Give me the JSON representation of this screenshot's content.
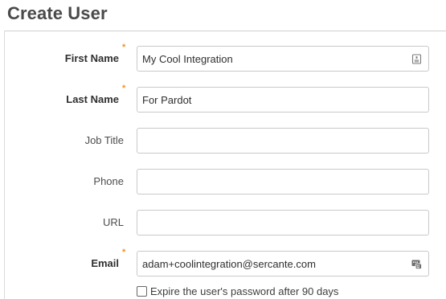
{
  "page": {
    "title": "Create User"
  },
  "form": {
    "first_name": {
      "label": "First Name",
      "value": "My Cool Integration",
      "required": true
    },
    "last_name": {
      "label": "Last Name",
      "value": "For Pardot",
      "required": true
    },
    "job_title": {
      "label": "Job Title",
      "value": ""
    },
    "phone": {
      "label": "Phone",
      "value": ""
    },
    "url": {
      "label": "URL",
      "value": ""
    },
    "email": {
      "label": "Email",
      "value": "adam+coolintegration@sercante.com",
      "required": true
    },
    "required_marker": "*",
    "password_expiry": {
      "label": "Expire the user's password after 90 days",
      "checked": false
    }
  },
  "icons": {
    "first_name_field": "contact-card-icon",
    "email_field": "autofill-icon"
  },
  "colors": {
    "required_marker": "#f0932b",
    "border": "#c9c9c9"
  }
}
